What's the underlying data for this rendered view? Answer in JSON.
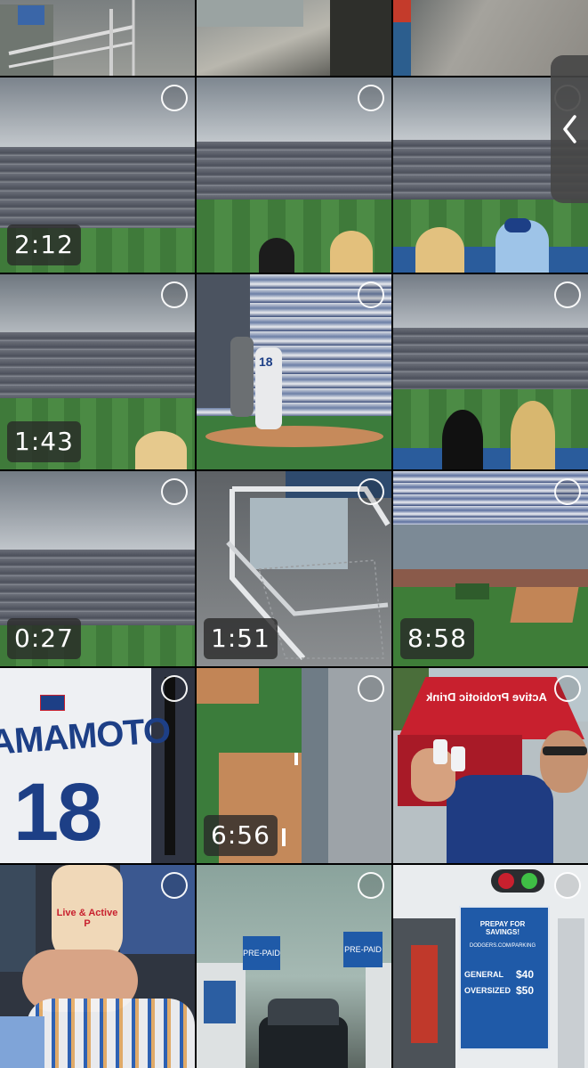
{
  "grid": {
    "columns": 3,
    "rows": [
      {
        "items": [
          {
            "kind": "photo",
            "scene": "concourse-railing"
          },
          {
            "kind": "photo",
            "scene": "concourse-floor"
          },
          {
            "kind": "photo",
            "scene": "concourse-wall"
          }
        ]
      },
      {
        "items": [
          {
            "kind": "video",
            "duration": "2:12",
            "scene": "stadium-wide"
          },
          {
            "kind": "photo",
            "scene": "stadium-wide-fans"
          },
          {
            "kind": "photo",
            "scene": "stadium-wide-fans"
          }
        ]
      },
      {
        "items": [
          {
            "kind": "video",
            "duration": "1:43",
            "scene": "stadium-wide-fan"
          },
          {
            "kind": "photo",
            "scene": "pitcher-on-mound",
            "jersey_text": "18"
          },
          {
            "kind": "photo",
            "scene": "stadium-wide-fans"
          }
        ]
      },
      {
        "items": [
          {
            "kind": "video",
            "duration": "0:27",
            "scene": "stadium-wide"
          },
          {
            "kind": "video",
            "duration": "1:51",
            "scene": "railing-down"
          },
          {
            "kind": "video",
            "duration": "8:58",
            "scene": "bullpen-overhead"
          }
        ]
      },
      {
        "items": [
          {
            "kind": "photo",
            "scene": "jersey-back",
            "jersey_name": "AMAMOTO",
            "jersey_number": "18"
          },
          {
            "kind": "video",
            "duration": "6:56",
            "scene": "mound-overhead"
          },
          {
            "kind": "photo",
            "scene": "probiotic-booth",
            "booth_sign": "Active Probiotic Drink"
          }
        ]
      },
      {
        "items": [
          {
            "kind": "photo",
            "scene": "probiotic-bottles",
            "bottle_label": "Live & Active P"
          },
          {
            "kind": "photo",
            "scene": "prepaid-parking-lane",
            "sign_left": "PRE-PAID",
            "sign_right": "PRE-PAID"
          },
          {
            "kind": "photo",
            "scene": "parking-booth",
            "sign_title": "PREPAY FOR SAVINGS!",
            "sign_general": "GENERAL",
            "sign_general_price": "$40",
            "sign_oversized": "OVERSIZED",
            "sign_oversized_price": "$50",
            "sign_site": "DODGERS.COM/PARKING"
          }
        ]
      }
    ]
  },
  "side_handle": {
    "icon": "chevron-left-icon"
  },
  "colors": {
    "sky": "#9aa3ab",
    "stands": "#5a5f6a",
    "grass": "#3f7a3a",
    "dodger_blue": "#1d3f86",
    "booth_red": "#c8202e",
    "sign_blue": "#1f5aa8"
  }
}
